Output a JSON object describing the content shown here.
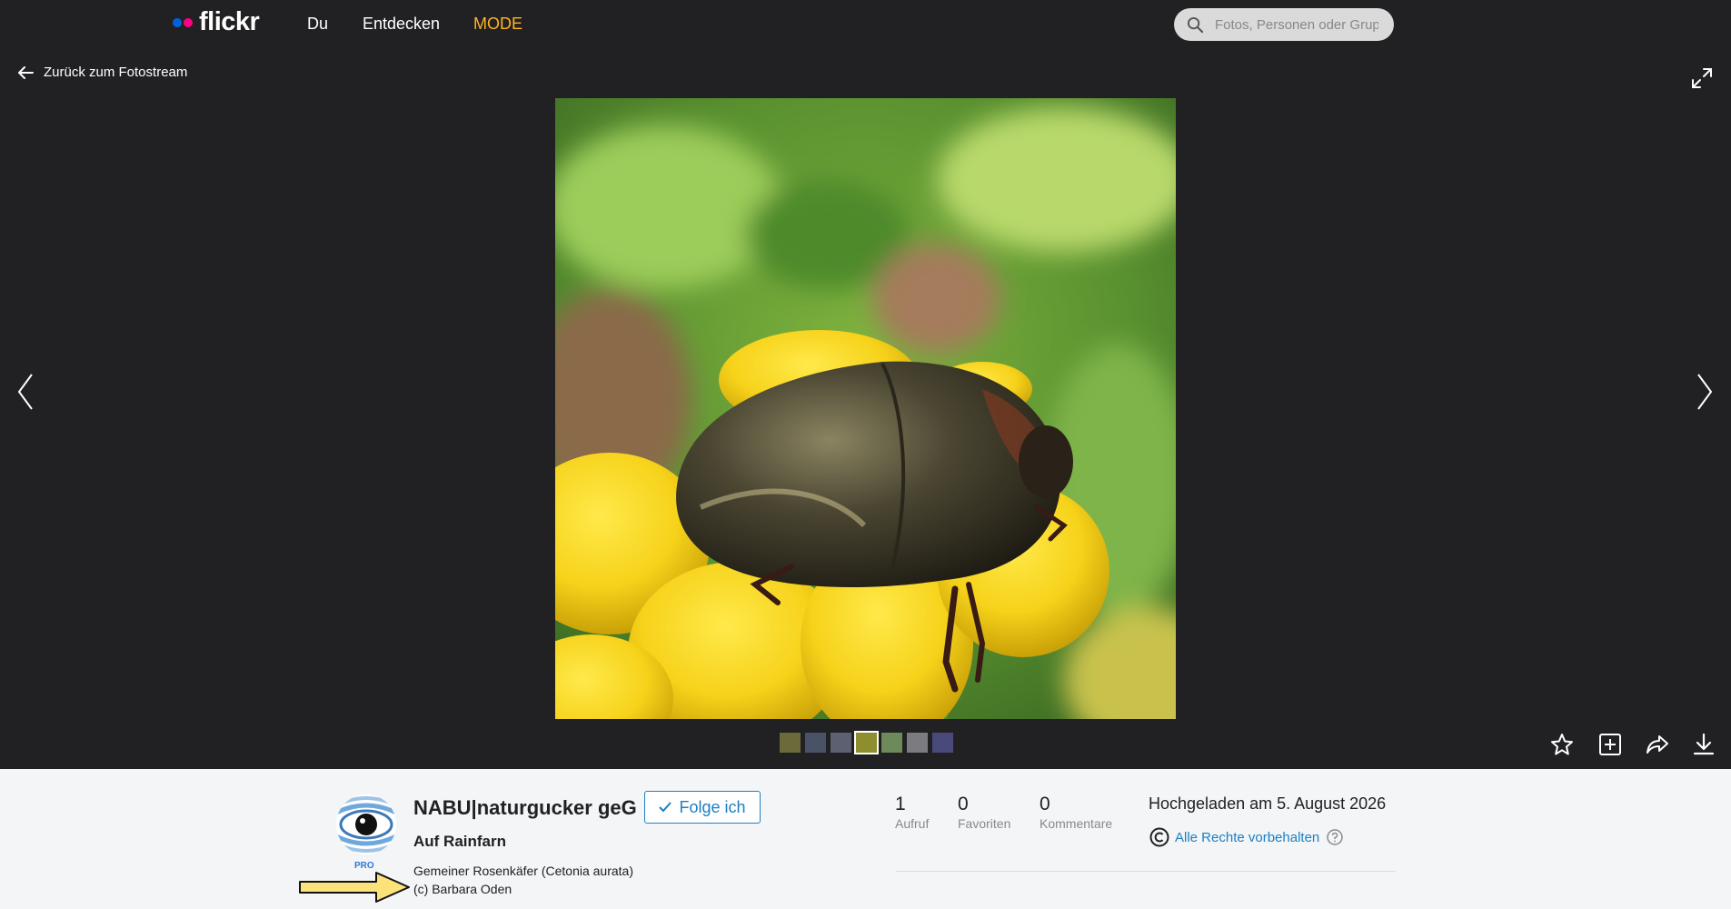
{
  "nav": {
    "logo": "flickr",
    "links": [
      "Du",
      "Entdecken",
      "MODE"
    ],
    "search_placeholder": "Fotos, Personen oder Gruppen"
  },
  "back_label": "Zurück zum Fotostream",
  "photo": {
    "thumbnail_count": 7
  },
  "owner": {
    "name": "NABU|naturgucker geG",
    "badge": "PRO",
    "follow_label": "Folge ich"
  },
  "photo_title": "Auf Rainfarn",
  "description": [
    "Gemeiner Rosenkäfer (Cetonia aurata)",
    "(c) Barbara Oden"
  ],
  "stats": [
    {
      "value": "1",
      "label": "Aufruf"
    },
    {
      "value": "0",
      "label": "Favoriten"
    },
    {
      "value": "0",
      "label": "Kommentare"
    }
  ],
  "uploaded": "Hochgeladen am 5. August 2026",
  "license": "Alle Rechte vorbehalten",
  "colors": {
    "nav_bg": "#212124",
    "accent_blue": "#1c7fc4",
    "mode_color": "#ffb41e",
    "flickr_blue": "#0063dc",
    "flickr_pink": "#ff0084"
  },
  "icons": [
    "search-icon",
    "back-arrow-icon",
    "expand-icon",
    "prev-arrow-icon",
    "next-arrow-icon",
    "favorite-star-icon",
    "add-to-gallery-icon",
    "share-icon",
    "download-icon",
    "check-icon",
    "copyright-icon",
    "help-icon",
    "pointer-arrow-icon"
  ]
}
